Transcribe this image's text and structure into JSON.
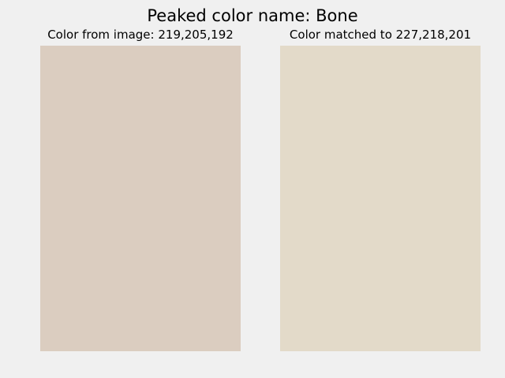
{
  "title": "Peaked color name: Bone",
  "panels": [
    {
      "title": "Color from image: 219,205,192",
      "rgb": [
        219,
        205,
        192
      ],
      "color": "#dbcdc0"
    },
    {
      "title": "Color matched to 227,218,201",
      "rgb": [
        227,
        218,
        201
      ],
      "color": "#e3dac9"
    }
  ],
  "colors": {
    "background": "#f0f0f0",
    "text": "#000000"
  }
}
